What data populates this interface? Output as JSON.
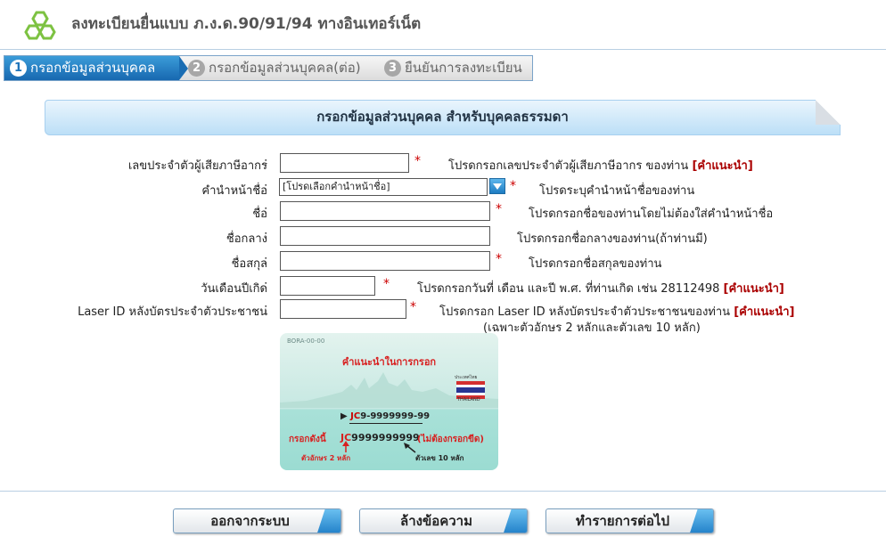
{
  "header": {
    "title": "ลงทะเบียนยื่นแบบ ภ.ง.ด.90/91/94 ทางอินเทอร์เน็ต"
  },
  "steps": [
    {
      "num": "1",
      "label": "กรอกข้อมูลส่วนบุคคล",
      "active": true
    },
    {
      "num": "2",
      "label": "กรอกข้อมูลส่วนบุคคล(ต่อ)",
      "active": false
    },
    {
      "num": "3",
      "label": "ยืนยันการลงทะเบียน",
      "active": false
    }
  ],
  "banner": {
    "title": "กรอกข้อมูลส่วนบุคคล สำหรับบุคคลธรรมดา"
  },
  "form": {
    "colon": ":",
    "required_mark": "*",
    "advice_label": "[คำแนะนำ]",
    "fields": {
      "tax_id": {
        "label": "เลขประจำตัวผู้เสียภาษีอากร",
        "value": "",
        "hint": "โปรดกรอกเลขประจำตัวผู้เสียภาษีอากร ของท่าน"
      },
      "title_prefix": {
        "label": "คำนำหน้าชื่อ",
        "selected": "[โปรดเลือกคำนำหน้าชื่อ]",
        "hint": "โปรดระบุคำนำหน้าชื่อของท่าน"
      },
      "first_name": {
        "label": "ชื่อ",
        "value": "",
        "hint": "โปรดกรอกชื่อของท่านโดยไม่ต้องใส่คำนำหน้าชื่อ"
      },
      "middle_name": {
        "label": "ชื่อกลาง",
        "value": "",
        "hint": "โปรดกรอกชื่อกลางของท่าน(ถ้าท่านมี)"
      },
      "last_name": {
        "label": "ชื่อสกุล",
        "value": "",
        "hint": "โปรดกรอกชื่อสกุลของท่าน"
      },
      "birth_date": {
        "label": "วันเดือนปีเกิด",
        "value": "",
        "hint": "โปรดกรอกวันที่ เดือน และปี พ.ศ. ที่ท่านเกิด เช่น 28112498"
      },
      "laser_id": {
        "label": "Laser ID หลังบัตรประจำตัวประชาชน",
        "value": "",
        "hint": "โปรดกรอก Laser ID หลังบัตรประจำตัวประชาชนของท่าน",
        "hint2": "(เฉพาะตัวอักษร 2 หลักและตัวเลข 10 หลัก)"
      }
    }
  },
  "card": {
    "code_small": "BORA-00-00",
    "title": "คำแนะนำในการกรอก",
    "flag_caption": "ประเทศไทย",
    "flag_country": "THAILAND",
    "sample_prefix": "JC",
    "sample_rest": "9-9999999-99",
    "fill_label": "กรอกดังนี้",
    "fill_prefix": "JC",
    "fill_rest": "9999999999",
    "no_dash": "(ไม่ต้องกรอกขีด)",
    "letters_note": "ตัวอักษร 2 หลัก",
    "digits_note": "ตัวเลข 10 หลัก"
  },
  "buttons": {
    "logout": "ออกจากระบบ",
    "clear": "ล้างข้อความ",
    "next": "ทำรายการต่อไป"
  },
  "colors": {
    "accent": "#1e74ba",
    "required": "#cc0000",
    "advice": "#aa0000"
  }
}
